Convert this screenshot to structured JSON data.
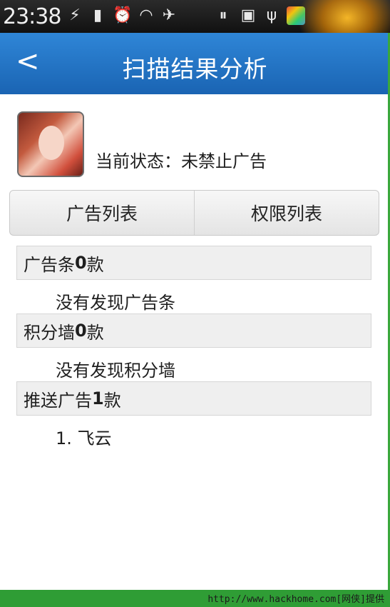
{
  "statusbar": {
    "time": "23:38",
    "icons": [
      "battery-charging-icon",
      "signal-icon",
      "alarm-icon",
      "wifi-icon",
      "airplane-icon",
      "pause-icon",
      "usb-storage-icon",
      "usb-icon",
      "app-icon"
    ]
  },
  "header": {
    "back_label": "<",
    "title": "扫描结果分析"
  },
  "status": {
    "text": "当前状态：未禁止广告"
  },
  "tabs": [
    {
      "label": "广告列表"
    },
    {
      "label": "权限列表"
    }
  ],
  "sections": [
    {
      "title_prefix": "广告条",
      "count": "0",
      "title_suffix": "款",
      "body": "没有发现广告条"
    },
    {
      "title_prefix": "积分墙",
      "count": "0",
      "title_suffix": "款",
      "body": "没有发现积分墙"
    },
    {
      "title_prefix": "推送广告",
      "count": "1",
      "title_suffix": "款",
      "body": "1. 飞云"
    }
  ],
  "footer": {
    "text": "http://www.hackhome.com[网侠]提供"
  },
  "colors": {
    "titlebar": "#1f6fc2",
    "footer": "#2f9d35"
  }
}
